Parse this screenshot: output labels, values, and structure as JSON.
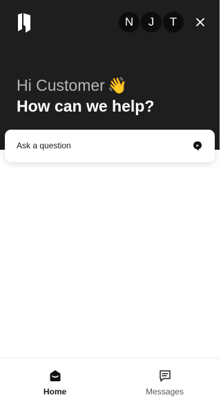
{
  "header": {
    "logo_icon": "intercom-logo-icon",
    "avatars": [
      "N",
      "J",
      "T"
    ],
    "close_icon": "close-icon",
    "greeting": "Hi Customer",
    "greeting_emoji": "👋",
    "headline": "How can we help?"
  },
  "ask": {
    "label": "Ask a question",
    "icon": "send-icon"
  },
  "tabbar": {
    "tabs": [
      {
        "label": "Home",
        "icon": "home-icon",
        "active": true
      },
      {
        "label": "Messages",
        "icon": "messages-icon",
        "active": false
      }
    ]
  },
  "colors": {
    "header_bg": "#1e1e1e",
    "greeting_text": "#b7b7b7",
    "headline_text": "#ffffff"
  }
}
